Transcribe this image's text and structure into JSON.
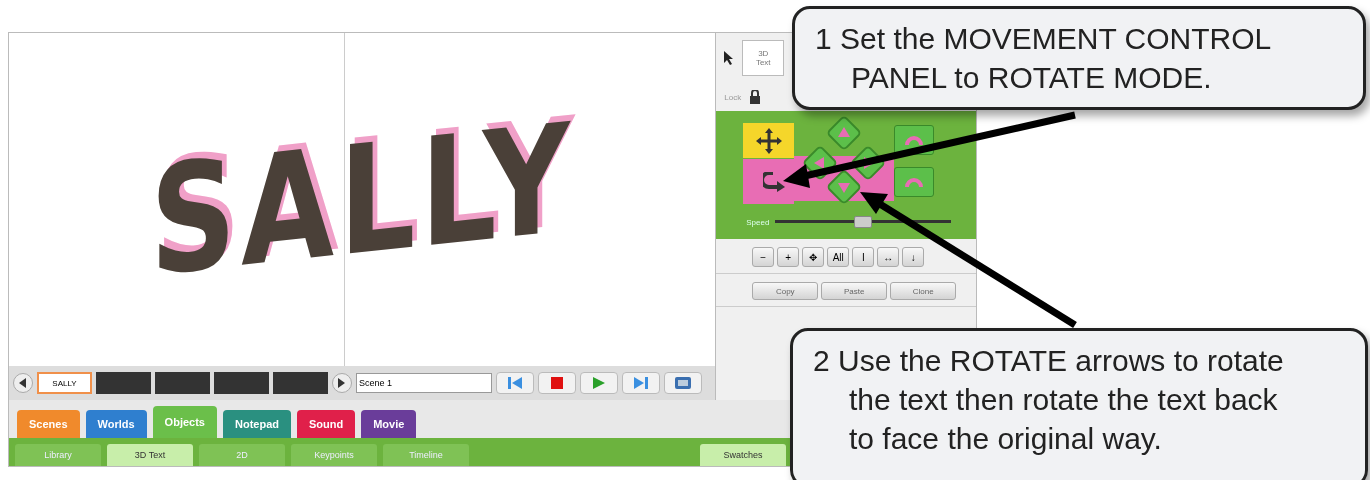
{
  "scene": {
    "model_text": "SALLY"
  },
  "side_panel": {
    "object_thumb": "3D\nText",
    "lock_label": "Lock",
    "speed_label": "Speed",
    "speed": {
      "level": 0.5
    },
    "tool_buttons": [
      {
        "label": "−"
      },
      {
        "label": "+"
      },
      {
        "label": "✥"
      },
      {
        "label": "All"
      },
      {
        "label": "I"
      },
      {
        "label": "↔"
      },
      {
        "label": "↓"
      }
    ],
    "edit_buttons": [
      "Copy",
      "Paste",
      "Clone"
    ]
  },
  "timeline": {
    "slots": [
      {
        "label": "SALLY",
        "kind": "filled"
      },
      {
        "kind": "empty"
      },
      {
        "kind": "empty"
      },
      {
        "kind": "empty"
      },
      {
        "kind": "empty"
      }
    ],
    "scene_name": "Scene 1"
  },
  "tabs": [
    {
      "label": "Scenes",
      "color": "#f08a2c",
      "selected": false
    },
    {
      "label": "Worlds",
      "color": "#2f7fcf",
      "selected": false
    },
    {
      "label": "Objects",
      "color": "#6bbf4a",
      "selected": true
    },
    {
      "label": "Notepad",
      "color": "#2a9080",
      "selected": false
    },
    {
      "label": "Sound",
      "color": "#e0204a",
      "selected": false
    },
    {
      "label": "Movie",
      "color": "#6a3d9a",
      "selected": false
    }
  ],
  "subtabs": [
    {
      "label": "Library",
      "selected": false
    },
    {
      "label": "3D Text",
      "selected": true
    },
    {
      "label": "2D",
      "selected": false
    },
    {
      "label": "Keypoints",
      "selected": false
    },
    {
      "label": "Timeline",
      "selected": false
    }
  ],
  "swatches_tab": "Swatches",
  "callouts": [
    {
      "text": "1  Set the MOVEMENT CONTROL PANEL to ROTATE MODE."
    },
    {
      "text": "2  Use the ROTATE arrows to rotate the text then rotate the text back to face the original way."
    }
  ]
}
